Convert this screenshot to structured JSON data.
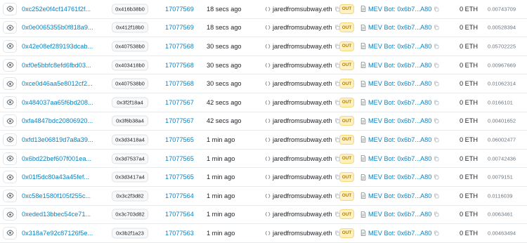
{
  "columns": {
    "status_badge_label": "OUT",
    "value": "0 ETH"
  },
  "icons": {
    "view": "eye-icon",
    "contract": "contract-icon",
    "copy": "copy-icon",
    "document": "document-icon"
  },
  "colors": {
    "link": "#0784c3",
    "out_badge_bg": "#fff1c2",
    "out_badge_text": "#b47d00",
    "border": "#e9ecef"
  },
  "rows": [
    {
      "hash": "0xc252e0f4cf14761f2f...",
      "method": "0x416b38b0",
      "block": "17077569",
      "age": "18 secs ago",
      "from": "jaredfromsubway.eth",
      "direction": "OUT",
      "to": "MEV Bot: 0x6b7...A80",
      "value": "0 ETH",
      "fee": "0.00743709"
    },
    {
      "hash": "0x0e0065355b0f818a9...",
      "method": "0x412f18b0",
      "block": "17077569",
      "age": "18 secs ago",
      "from": "jaredfromsubway.eth",
      "direction": "OUT",
      "to": "MEV Bot: 0x6b7...A80",
      "value": "0 ETH",
      "fee": "0.00528394"
    },
    {
      "hash": "0x42e08ef289193dcab...",
      "method": "0x407538b0",
      "block": "17077568",
      "age": "30 secs ago",
      "from": "jaredfromsubway.eth",
      "direction": "OUT",
      "to": "MEV Bot: 0x6b7...A80",
      "value": "0 ETH",
      "fee": "0.05702225"
    },
    {
      "hash": "0xf0e5bbfc8efd6fbd03...",
      "method": "0x403418b0",
      "block": "17077568",
      "age": "30 secs ago",
      "from": "jaredfromsubway.eth",
      "direction": "OUT",
      "to": "MEV Bot: 0x6b7...A80",
      "value": "0 ETH",
      "fee": "0.00967669"
    },
    {
      "hash": "0xce0d46aa5e8012cf2...",
      "method": "0x407538b0",
      "block": "17077568",
      "age": "30 secs ago",
      "from": "jaredfromsubway.eth",
      "direction": "OUT",
      "to": "MEV Bot: 0x6b7...A80",
      "value": "0 ETH",
      "fee": "0.01062314"
    },
    {
      "hash": "0x484037aa65f6bd208...",
      "method": "0x3f2f18a4",
      "block": "17077567",
      "age": "42 secs ago",
      "from": "jaredfromsubway.eth",
      "direction": "OUT",
      "to": "MEV Bot: 0x6b7...A80",
      "value": "0 ETH",
      "fee": "0.0166101"
    },
    {
      "hash": "0xfa4847bdc20806920...",
      "method": "0x3f6b38a4",
      "block": "17077567",
      "age": "42 secs ago",
      "from": "jaredfromsubway.eth",
      "direction": "OUT",
      "to": "MEV Bot: 0x6b7...A80",
      "value": "0 ETH",
      "fee": "0.00401652"
    },
    {
      "hash": "0xfd13e06819d7a8a39...",
      "method": "0x3d3418a4",
      "block": "17077565",
      "age": "1 min ago",
      "from": "jaredfromsubway.eth",
      "direction": "OUT",
      "to": "MEV Bot: 0x6b7...A80",
      "value": "0 ETH",
      "fee": "0.06002477"
    },
    {
      "hash": "0x6bd22bef607f001ea...",
      "method": "0x3d7537a4",
      "block": "17077565",
      "age": "1 min ago",
      "from": "jaredfromsubway.eth",
      "direction": "OUT",
      "to": "MEV Bot: 0x6b7...A80",
      "value": "0 ETH",
      "fee": "0.00742436"
    },
    {
      "hash": "0x01f5dc80a43a45fef...",
      "method": "0x3d3417a4",
      "block": "17077565",
      "age": "1 min ago",
      "from": "jaredfromsubway.eth",
      "direction": "OUT",
      "to": "MEV Bot: 0x6b7...A80",
      "value": "0 ETH",
      "fee": "0.0079151"
    },
    {
      "hash": "0xc58e1580f105f255c...",
      "method": "0x3c2f3d82",
      "block": "17077564",
      "age": "1 min ago",
      "from": "jaredfromsubway.eth",
      "direction": "OUT",
      "to": "MEV Bot: 0x6b7...A80",
      "value": "0 ETH",
      "fee": "0.0116039"
    },
    {
      "hash": "0xeded13bbec54ce71...",
      "method": "0x3c703d82",
      "block": "17077564",
      "age": "1 min ago",
      "from": "jaredfromsubway.eth",
      "direction": "OUT",
      "to": "MEV Bot: 0x6b7...A80",
      "value": "0 ETH",
      "fee": "0.0063461"
    },
    {
      "hash": "0x318a7e92c87126f5e...",
      "method": "0x3b2f1a23",
      "block": "17077563",
      "age": "1 min ago",
      "from": "jaredfromsubway.eth",
      "direction": "OUT",
      "to": "MEV Bot: 0x6b7...A80",
      "value": "0 ETH",
      "fee": "0.00463494"
    }
  ]
}
